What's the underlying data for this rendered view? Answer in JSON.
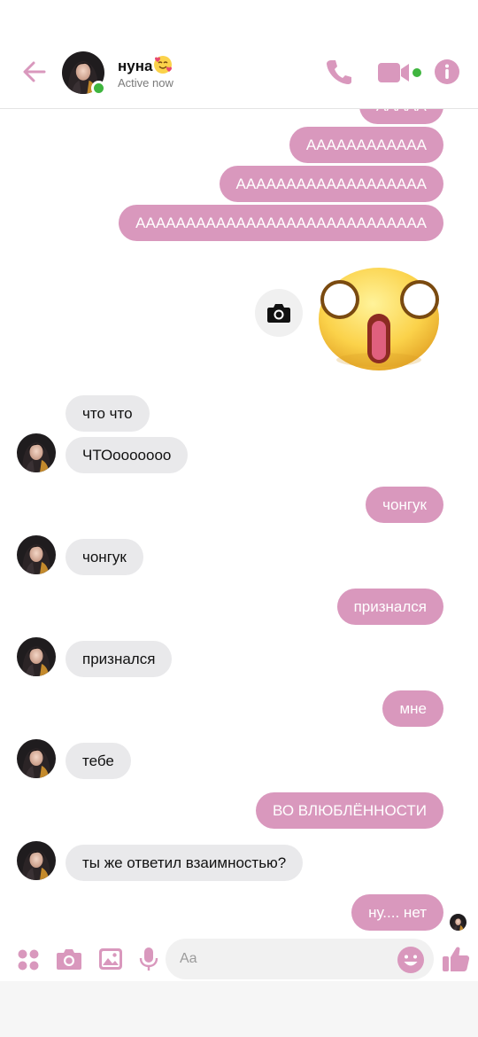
{
  "header": {
    "contact_name": "нуна",
    "status": "Active now"
  },
  "messages": {
    "out_partial": "ААААА",
    "out1": "АААААААААААА",
    "out2": "ААААААААААААААААААА",
    "out3": "ААААААААААААААААААААААААААААА",
    "in1": "что что",
    "in2": "ЧТОooooooo",
    "out4": "чонгук",
    "in3": "чонгук",
    "out5": "признался",
    "in4": "признался",
    "out6": "мне",
    "in5": "тебе",
    "out7": "ВО ВЛЮБЛЁННОСТИ",
    "in6": "ты же ответил взаимностью?",
    "out8": "ну.... нет"
  },
  "composer": {
    "placeholder": "Aa"
  },
  "colors": {
    "accent": "#d998bd",
    "incoming_bubble": "#e9e9eb",
    "online": "#3fb53f"
  },
  "icons": {
    "back": "back-arrow-icon",
    "call": "phone-icon",
    "video": "video-camera-icon",
    "info": "info-icon",
    "apps": "apps-grid-icon",
    "camera": "camera-icon",
    "gallery": "gallery-icon",
    "mic": "microphone-icon",
    "emoji": "emoji-smile-icon",
    "like": "thumbs-up-icon"
  }
}
